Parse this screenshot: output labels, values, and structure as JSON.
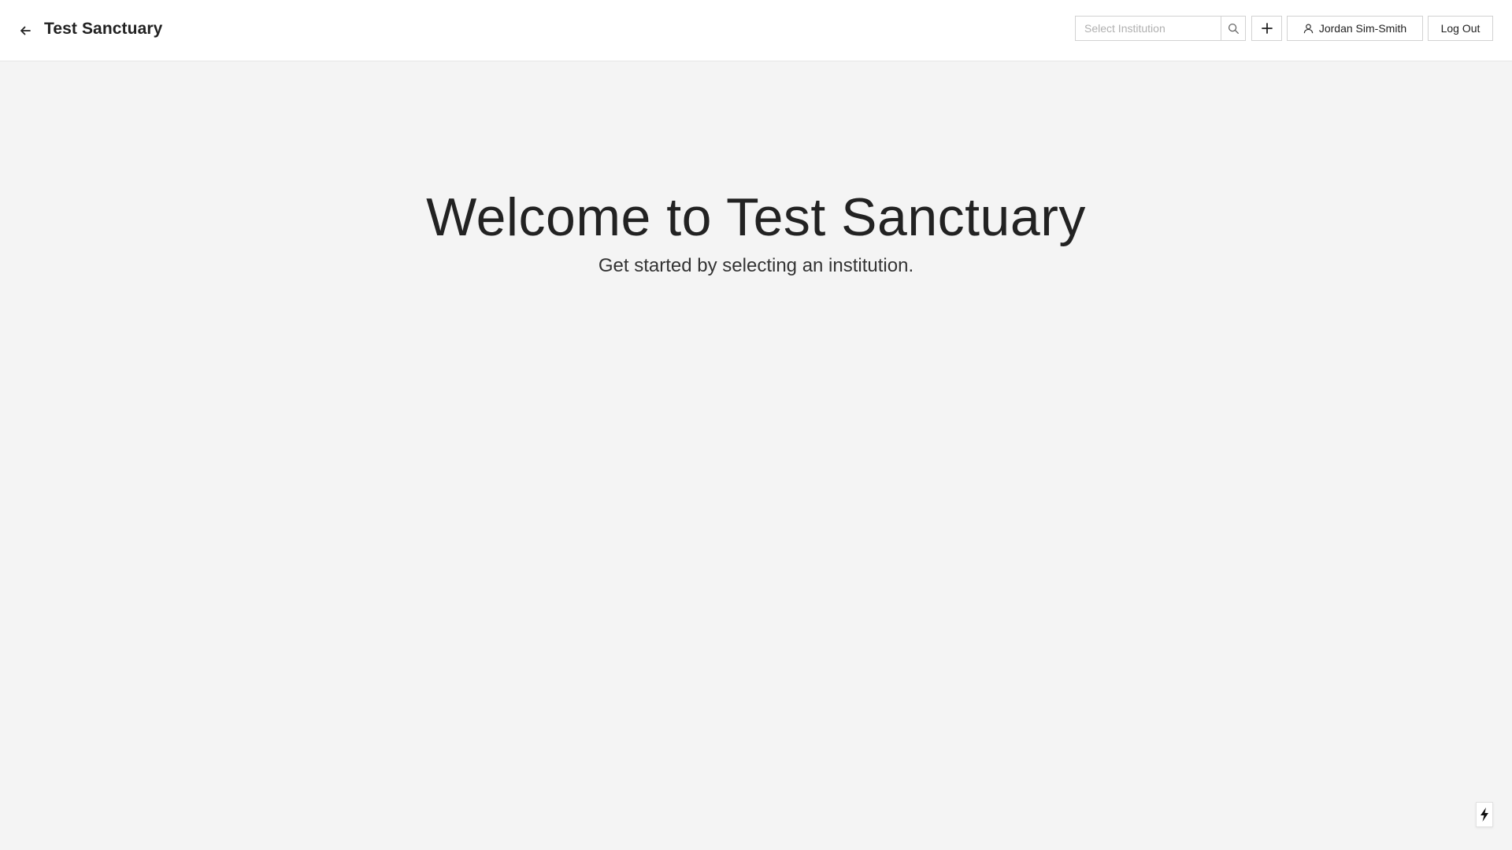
{
  "header": {
    "title": "Test Sanctuary",
    "back_icon": "arrow-left-icon",
    "search": {
      "placeholder": "Select Institution",
      "value": "",
      "icon": "search-icon"
    },
    "add_icon": "plus-icon",
    "user": {
      "name": "Jordan Sim-Smith",
      "icon": "user-icon"
    },
    "logout_label": "Log Out"
  },
  "main": {
    "title": "Welcome to Test Sanctuary",
    "subtitle": "Get started by selecting an institution."
  },
  "floating": {
    "icon": "lightning-bolt-icon"
  }
}
